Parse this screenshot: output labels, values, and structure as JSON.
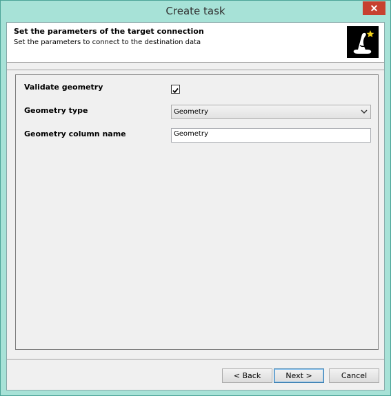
{
  "window": {
    "title": "Create task",
    "close_symbol": "✕"
  },
  "header": {
    "title": "Set the parameters of the target connection",
    "subtitle": "Set the parameters to connect to the destination data",
    "logo_icon": "wizard-hat-star-icon"
  },
  "form": {
    "validate_geometry": {
      "label": "Validate geometry",
      "checked": true
    },
    "geometry_type": {
      "label": "Geometry type",
      "selected": "Geometry"
    },
    "geometry_column": {
      "label": "Geometry column name",
      "value": "Geometry"
    }
  },
  "buttons": {
    "back": "< Back",
    "next": "Next >",
    "cancel": "Cancel"
  },
  "colors": {
    "frame": "#a7e2d7",
    "close": "#c7402f"
  }
}
